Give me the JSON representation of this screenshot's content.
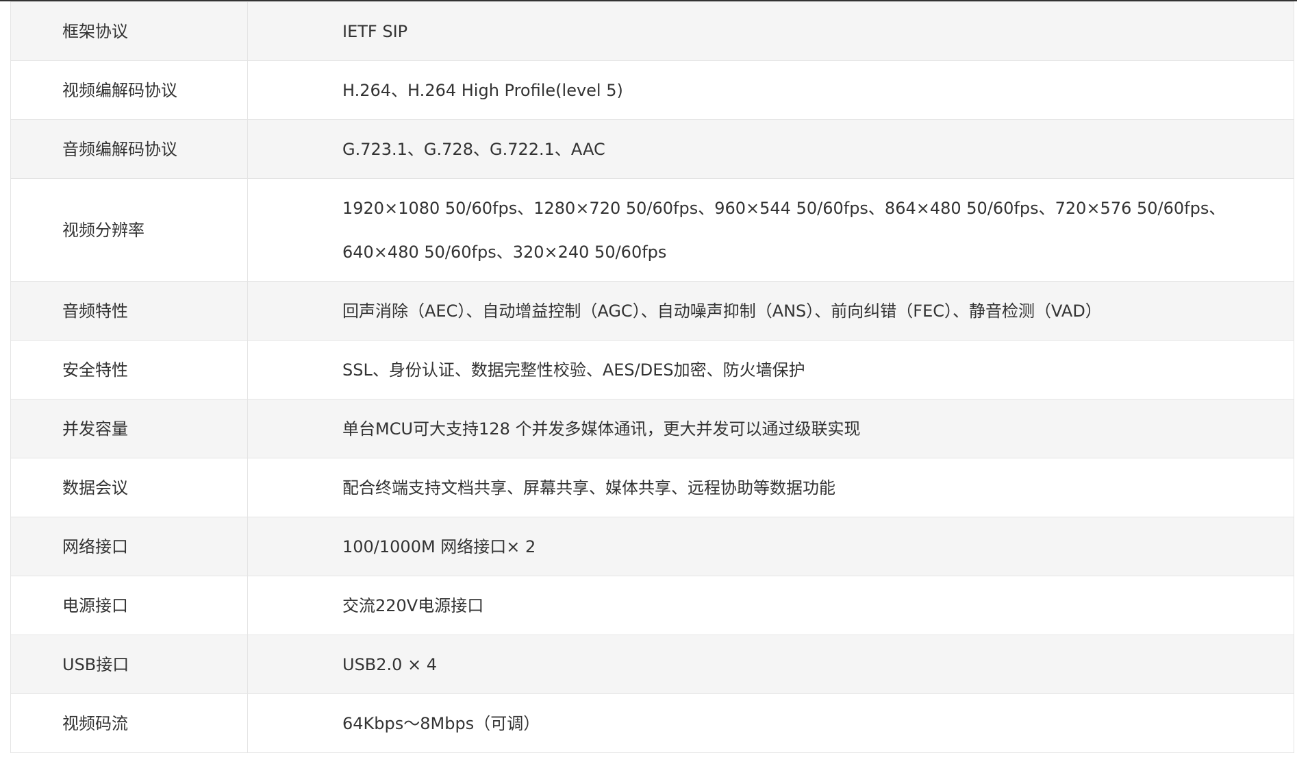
{
  "spec_table": {
    "rows": [
      {
        "label": "框架协议",
        "value": "IETF SIP"
      },
      {
        "label": "视频编解码协议",
        "value": "H.264、H.264 High Profile(level 5)"
      },
      {
        "label": "音频编解码协议",
        "value": "G.723.1、G.728、G.722.1、AAC"
      },
      {
        "label": "视频分辨率",
        "value": "1920×1080 50/60fps、1280×720 50/60fps、960×544 50/60fps、864×480 50/60fps、720×576 50/60fps、640×480 50/60fps、320×240 50/60fps"
      },
      {
        "label": "音频特性",
        "value": "回声消除（AEC）、自动增益控制（AGC）、自动噪声抑制（ANS）、前向纠错（FEC）、静音检测（VAD）"
      },
      {
        "label": "安全特性",
        "value": "SSL、身份认证、数据完整性校验、AES/DES加密、防火墙保护"
      },
      {
        "label": "并发容量",
        "value": "单台MCU可大支持128 个并发多媒体通讯，更大并发可以通过级联实现"
      },
      {
        "label": "数据会议",
        "value": "配合终端支持文档共享、屏幕共享、媒体共享、远程协助等数据功能"
      },
      {
        "label": "网络接口",
        "value": "100/1000M 网络接口× 2"
      },
      {
        "label": "电源接口",
        "value": "交流220V电源接口"
      },
      {
        "label": "USB接口",
        "value": "USB2.0 × 4"
      },
      {
        "label": "视频码流",
        "value": "64Kbps～8Mbps（可调）"
      }
    ]
  }
}
